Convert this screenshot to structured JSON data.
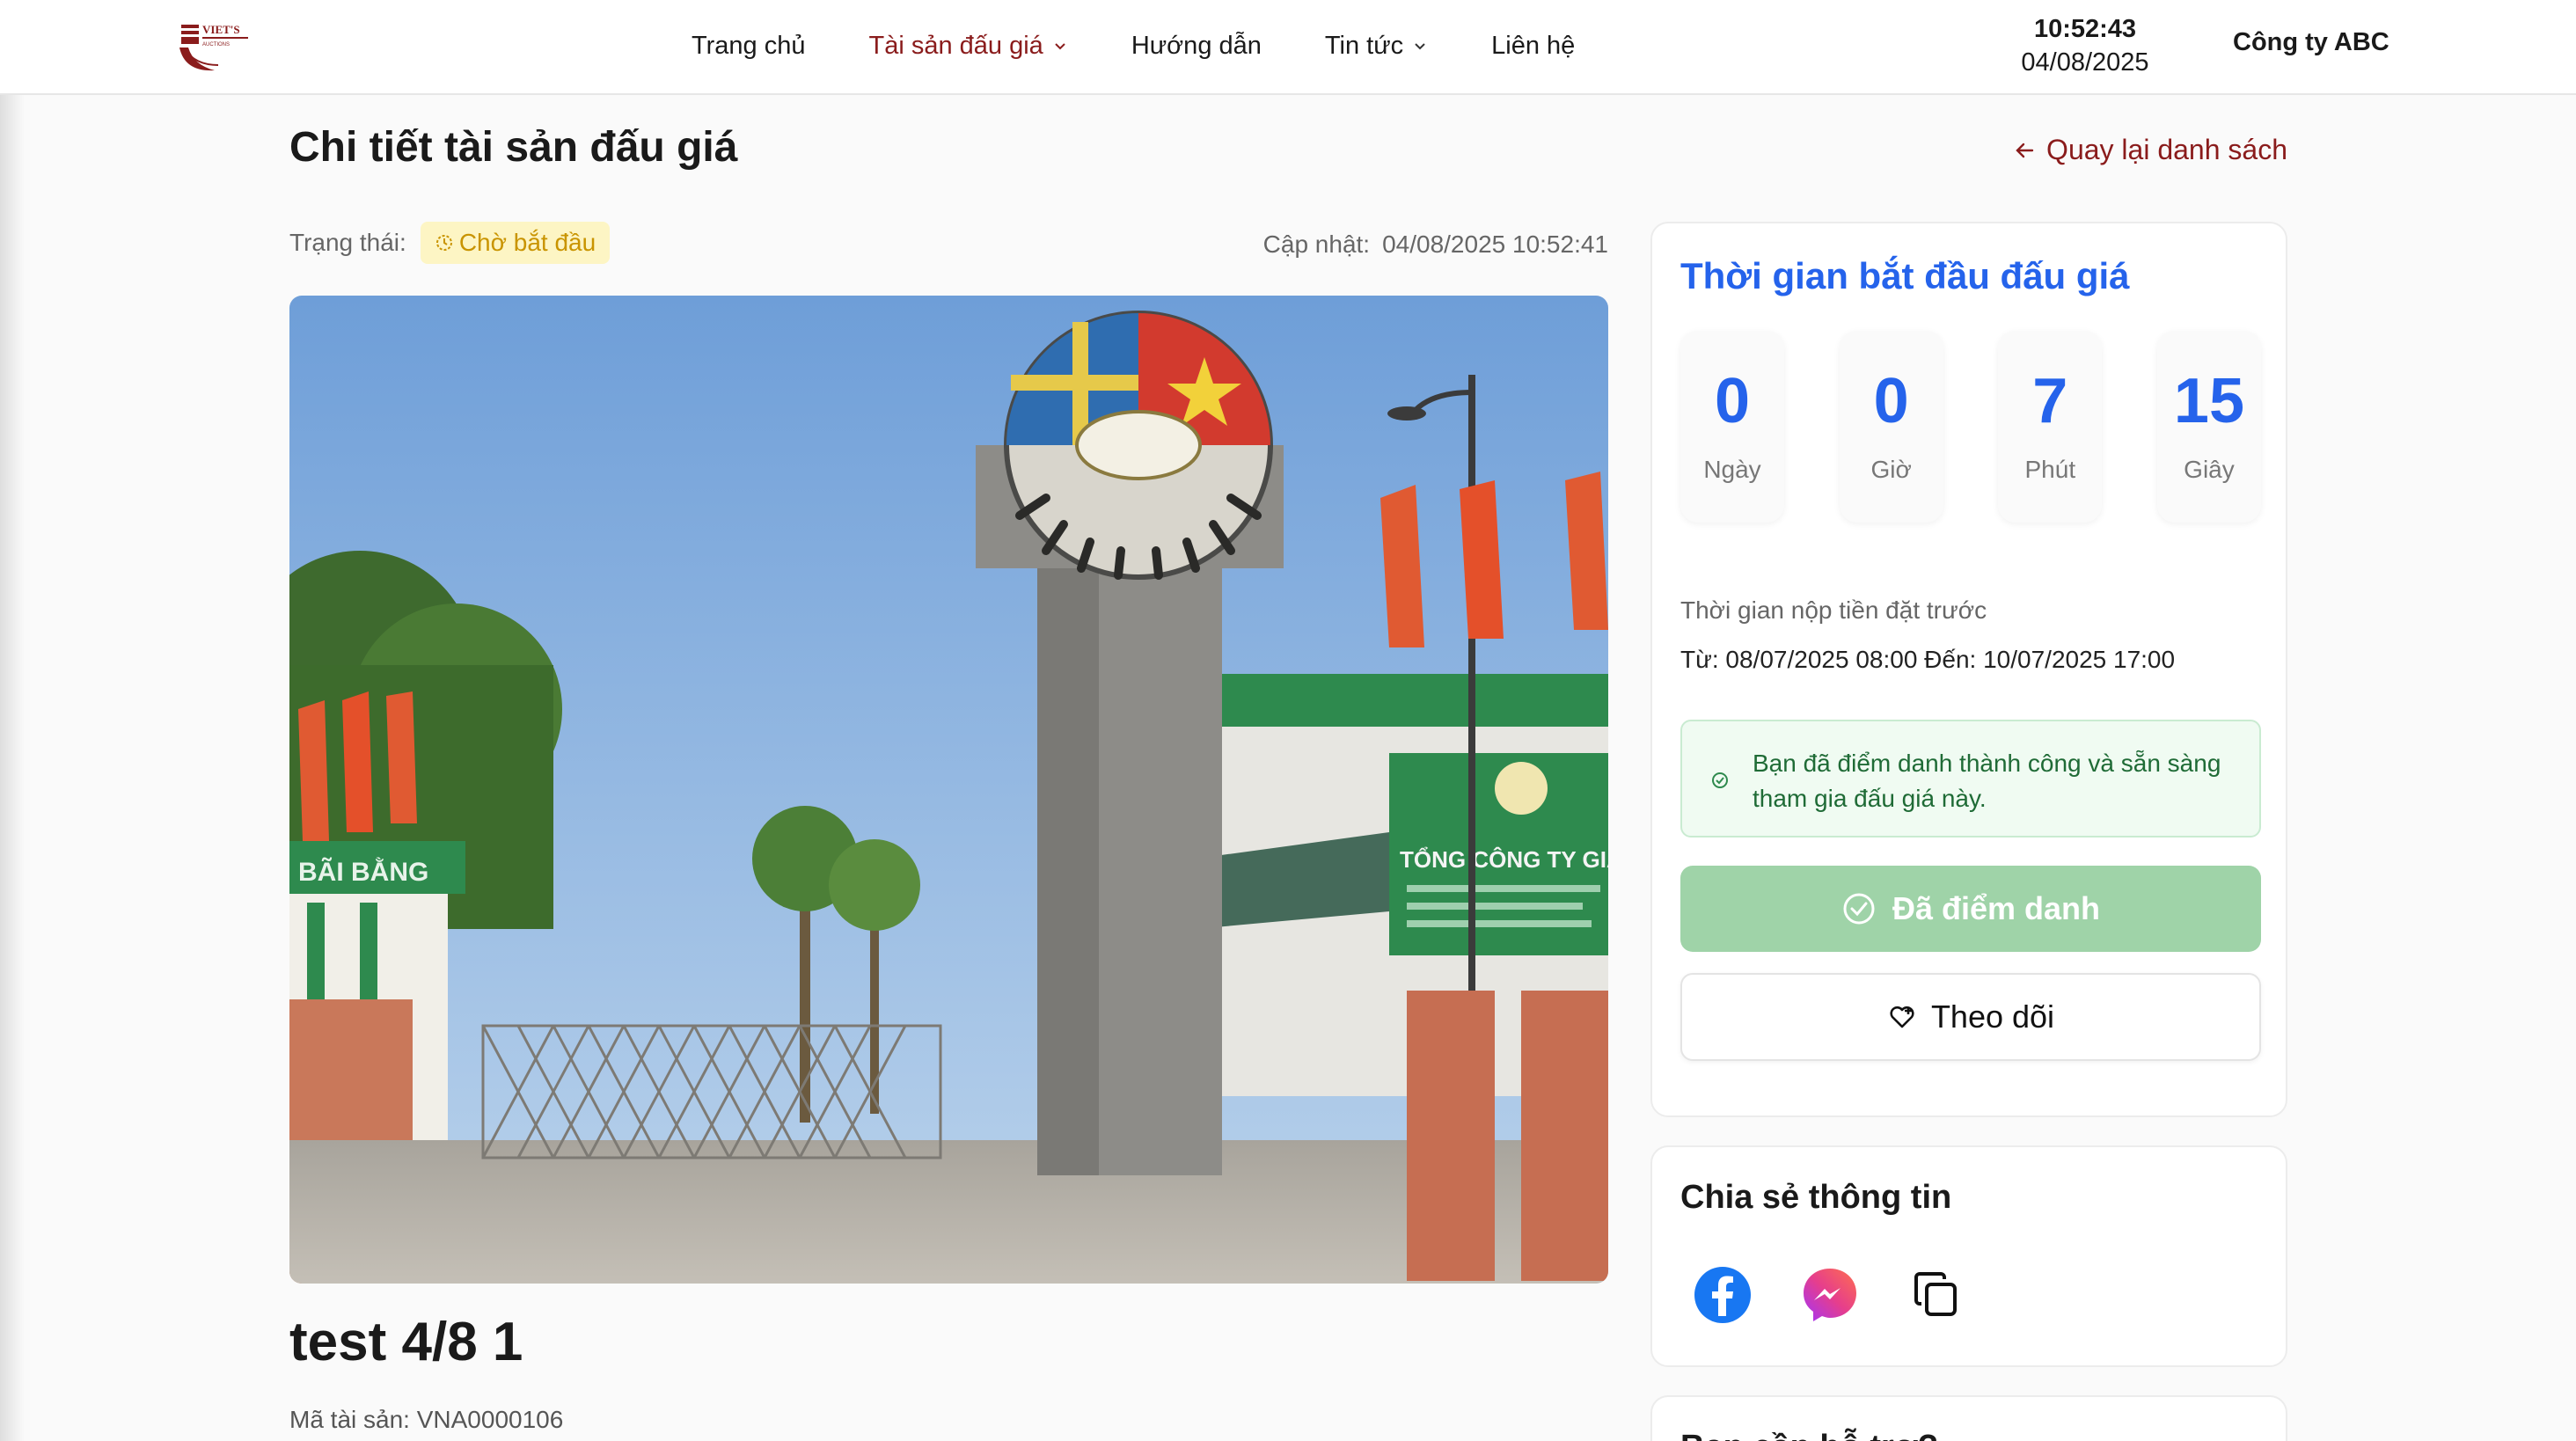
{
  "header": {
    "logo_text": "VIET'S",
    "nav": [
      {
        "label": "Trang chủ",
        "dropdown": false,
        "active": false
      },
      {
        "label": "Tài sản đấu giá",
        "dropdown": true,
        "active": true
      },
      {
        "label": "Hướng dẫn",
        "dropdown": false,
        "active": false
      },
      {
        "label": "Tin tức",
        "dropdown": true,
        "active": false
      },
      {
        "label": "Liên hệ",
        "dropdown": false,
        "active": false
      }
    ],
    "clock": {
      "time": "10:52:43",
      "date": "04/08/2025"
    },
    "company": "Công ty ABC"
  },
  "page": {
    "title": "Chi tiết tài sản đấu giá",
    "back_link": "Quay lại danh sách",
    "status_label": "Trạng thái:",
    "status_value": "Chờ bắt đầu",
    "updated_label": "Cập nhật:",
    "updated_value": "04/08/2025 10:52:41",
    "asset_name": "test 4/8 1",
    "asset_code": "Mã tài sản: VNA0000106"
  },
  "countdown_card": {
    "title": "Thời gian bắt đầu đấu giá",
    "units": [
      {
        "value": "0",
        "label": "Ngày"
      },
      {
        "value": "0",
        "label": "Giờ"
      },
      {
        "value": "7",
        "label": "Phút"
      },
      {
        "value": "15",
        "label": "Giây"
      }
    ],
    "deposit_label": "Thời gian nộp tiền đặt trước",
    "deposit_range": "Từ: 08/07/2025 08:00 Đến: 10/07/2025 17:00",
    "notice": "Bạn đã điểm danh thành công và sẵn sàng tham gia đấu giá này.",
    "checked_in_button": "Đã điểm danh",
    "follow_button": "Theo dõi"
  },
  "share_card": {
    "title": "Chia sẻ thông tin",
    "icons": [
      "facebook-icon",
      "messenger-icon",
      "copy-icon"
    ]
  },
  "next_card": {
    "title": "Bạn cần hỗ trợ?"
  },
  "colors": {
    "accent_blue": "#2563eb",
    "brand_red": "#8a1c1c",
    "status_yellow": "#c99400",
    "success_green": "#9fd3a8"
  }
}
